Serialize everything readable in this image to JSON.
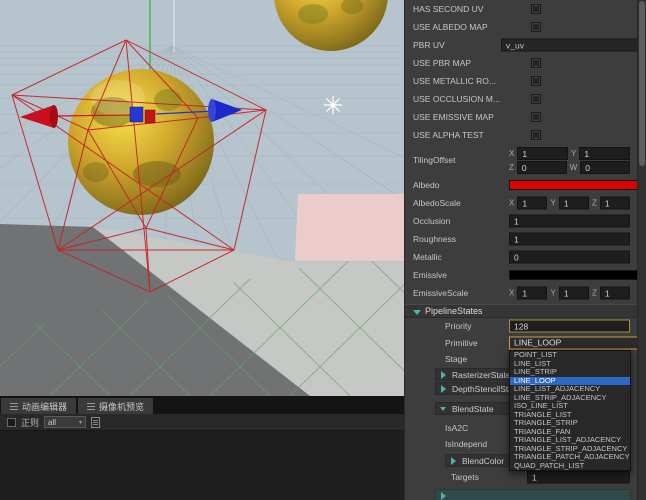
{
  "inspector": {
    "toggles": [
      {
        "label": "HAS SECOND UV"
      },
      {
        "label": "USE ALBEDO MAP"
      },
      {
        "label": "USE PBR MAP"
      },
      {
        "label": "USE METALLIC RO..."
      },
      {
        "label": "USE OCCLUSION M..."
      },
      {
        "label": "USE EMISSIVE MAP"
      },
      {
        "label": "USE ALPHA TEST"
      }
    ],
    "pbr_uv": {
      "label": "PBR UV",
      "value": "v_uv"
    },
    "axes": [
      "X",
      "Y",
      "Z",
      "W"
    ],
    "tiling_offset": {
      "label": "TilingOffset",
      "x": "1",
      "y": "1",
      "z": "0",
      "w": "0"
    },
    "albedo": {
      "label": "Albedo",
      "color": "#dc0303"
    },
    "albedo_scale": {
      "label": "AlbedoScale",
      "x": "1",
      "y": "1",
      "z": "1"
    },
    "occlusion": {
      "label": "Occlusion",
      "value": "1"
    },
    "roughness": {
      "label": "Roughness",
      "value": "1"
    },
    "metallic": {
      "label": "Metallic",
      "value": "0"
    },
    "emissive": {
      "label": "Emissive",
      "color": "#000000"
    },
    "emissive_scale": {
      "label": "EmissiveScale",
      "x": "1",
      "y": "1",
      "z": "1"
    },
    "pipeline": {
      "header": "PipelineStates",
      "priority_label": "Priority",
      "priority_value": "128",
      "primitive_label": "Primitive",
      "stage_label": "Stage",
      "rasterizer_label": "RasterizerState",
      "depth_stencil_label": "DepthStencilState",
      "blend_label": "BlendState",
      "is_a2c_label": "IsA2C",
      "is_independ_label": "IsIndepend",
      "blend_color_label": "BlendColor",
      "targets_label": "Targets",
      "targets_value": "1"
    },
    "primitive_dropdown": {
      "selected": "LINE_LOOP",
      "selected_index": 3,
      "options": [
        "POINT_LIST",
        "LINE_LIST",
        "LINE_STRIP",
        "LINE_LOOP",
        "LINE_LIST_ADJACENCY",
        "LINE_STRIP_ADJACENCY",
        "ISO_LINE_LIST",
        "TRIANGLE_LIST",
        "TRIANGLE_STRIP",
        "TRIANGLE_FAN",
        "TRIANGLE_LIST_ADJACENCY",
        "TRIANGLE_STRIP_ADJACENCY",
        "TRIANGLE_PATCH_ADJACENCY",
        "QUAD_PATCH_LIST"
      ]
    }
  },
  "bottom_dock": {
    "tabs": [
      {
        "label": "动画编辑器"
      },
      {
        "label": "摄像机预览"
      }
    ],
    "toolbar": {
      "regex_label": "正则",
      "filter_value": "all"
    }
  },
  "colors": {
    "dropdown_highlight_border": "#cf9b46",
    "selected_option_bg": "#2d68c4",
    "albedo_swatch": "#dc0303",
    "emissive_swatch": "#000000"
  }
}
